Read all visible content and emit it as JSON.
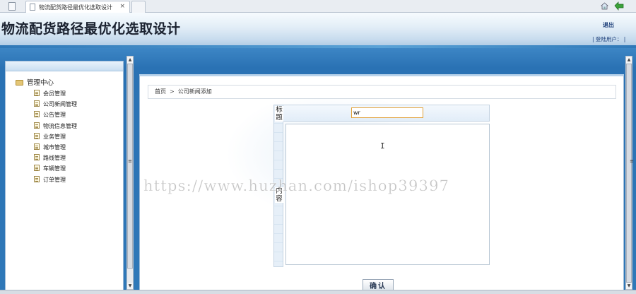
{
  "browser": {
    "tab_title": "物流配货路径最优化选取设计",
    "tab_close": "×"
  },
  "header": {
    "site_title": "物流配货路径最优化选取设计",
    "logout_label": "退出",
    "login_user_label": "| 登陆用户： |"
  },
  "sidebar": {
    "root_label": "管理中心",
    "items": [
      {
        "label": "会员管理"
      },
      {
        "label": "公司新闻管理"
      },
      {
        "label": "公告管理"
      },
      {
        "label": "物流信息管理"
      },
      {
        "label": "业务管理"
      },
      {
        "label": "城市管理"
      },
      {
        "label": "路线管理"
      },
      {
        "label": "车辆管理"
      },
      {
        "label": "订单管理"
      }
    ]
  },
  "breadcrumb": {
    "home": "首页",
    "separator": ">",
    "current": "公司新闻添加"
  },
  "form": {
    "title_label": "标题",
    "title_value": "wr",
    "content_label": "内容",
    "submit_label": "确认"
  },
  "watermark": "https://www.huzhan.com/ishop39397",
  "colors": {
    "main_blue": "#2f78b8",
    "input_focus_border": "#e2a23a"
  },
  "icons": {
    "tree_root": "folder-open-icon",
    "tree_item": "document-icon",
    "toolbar_home": "home-icon",
    "toolbar_back": "back-arrow-icon"
  }
}
